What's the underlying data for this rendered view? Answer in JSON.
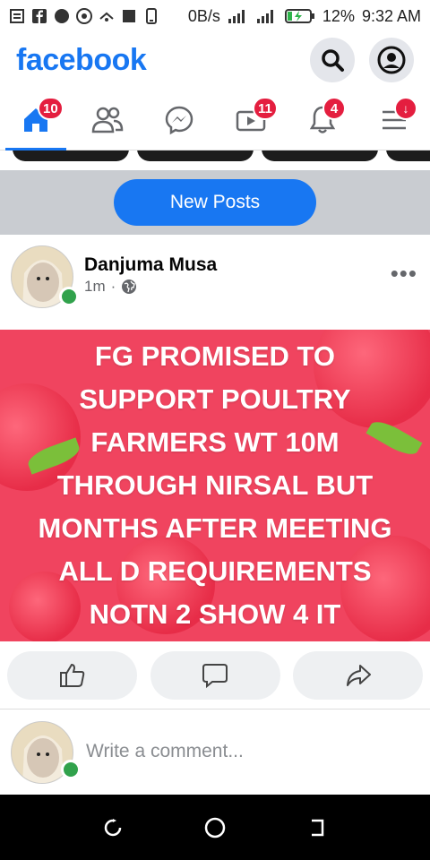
{
  "status_bar": {
    "network_speed": "0B/s",
    "battery_percent": "12%",
    "time": "9:32 AM"
  },
  "header": {
    "logo_text": "facebook",
    "search_icon": "search-icon",
    "profile_icon": "profile-icon"
  },
  "nav": {
    "tabs": [
      {
        "name": "home",
        "icon": "home-icon",
        "badge": "10",
        "active": true
      },
      {
        "name": "friends",
        "icon": "friends-icon",
        "badge": null
      },
      {
        "name": "messenger",
        "icon": "messenger-icon",
        "badge": null
      },
      {
        "name": "watch",
        "icon": "watch-icon",
        "badge": "11"
      },
      {
        "name": "notifications",
        "icon": "bell-icon",
        "badge": "4"
      },
      {
        "name": "menu",
        "icon": "menu-icon",
        "badge": "↓"
      }
    ]
  },
  "new_posts": {
    "label": "New Posts"
  },
  "post": {
    "author": "Danjuma Musa",
    "time": "1m",
    "separator": "·",
    "audience_icon": "globe-icon",
    "more_label": "•••",
    "lines": [
      "FG PROMISED TO",
      "SUPPORT POULTRY",
      "FARMERS WT 10M",
      "THROUGH NIRSAL BUT",
      "MONTHS AFTER MEETING",
      "ALL  D REQUIREMENTS",
      "NOTN 2 SHOW 4 IT"
    ],
    "background_color": "#f0445f"
  },
  "actions": {
    "like_icon": "thumbs-up-icon",
    "comment_icon": "comment-icon",
    "share_icon": "share-icon"
  },
  "comment": {
    "placeholder": "Write a comment..."
  },
  "colors": {
    "brand": "#1877f2",
    "badge": "#e41e3f",
    "online": "#31a24c"
  }
}
